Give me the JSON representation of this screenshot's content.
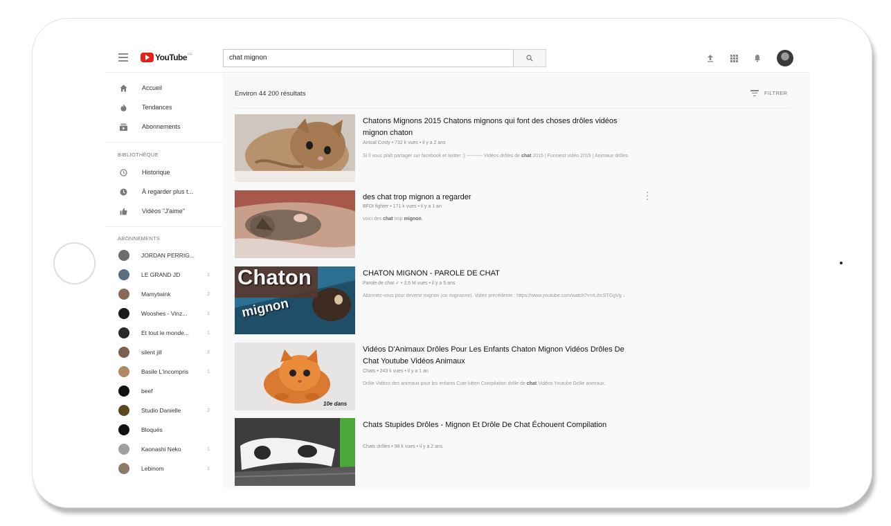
{
  "header": {
    "logo_text": "YouTube",
    "logo_region": "FR",
    "search_value": "chat mignon",
    "icons": [
      "menu-icon",
      "search-icon",
      "upload-icon",
      "apps-icon",
      "bell-icon",
      "avatar"
    ]
  },
  "sidebar": {
    "main_items": [
      {
        "label": "Accueil",
        "icon": "home-icon"
      },
      {
        "label": "Tendances",
        "icon": "flame-icon"
      },
      {
        "label": "Abonnements",
        "icon": "subscriptions-icon"
      }
    ],
    "library_heading": "BIBLIOTHÈQUE",
    "library_items": [
      {
        "label": "Historique",
        "icon": "history-icon"
      },
      {
        "label": "À regarder plus t...",
        "icon": "clock-icon"
      },
      {
        "label": "Vidéos \"J'aime\"",
        "icon": "thumbs-up-icon"
      }
    ],
    "subscriptions_heading": "ABONNEMENTS",
    "subscriptions": [
      {
        "label": "JORDAN PERRIG...",
        "count": "",
        "color": "#6e6e6e"
      },
      {
        "label": "LE GRAND JD",
        "count": "1",
        "color": "#5a6e7e"
      },
      {
        "label": "Mamytwink",
        "count": "2",
        "color": "#8a6a55"
      },
      {
        "label": "Wooshes - Vinz...",
        "count": "1",
        "color": "#1a1a1a"
      },
      {
        "label": "Et tout le monde...",
        "count": "1",
        "color": "#2a2a2a"
      },
      {
        "label": "silent jill",
        "count": "3",
        "color": "#7a6050"
      },
      {
        "label": "Basile L'incompris",
        "count": "1",
        "color": "#b08a60"
      },
      {
        "label": "beef",
        "count": "",
        "color": "#111111"
      },
      {
        "label": "Studio Danielle",
        "count": "2",
        "color": "#5b4a20"
      },
      {
        "label": "Bloqués",
        "count": "",
        "color": "#111111"
      },
      {
        "label": "Kaonashi Neko",
        "count": "1",
        "color": "#a0a0a0"
      },
      {
        "label": "Lebinom",
        "count": "1",
        "color": "#8a7a6a"
      }
    ]
  },
  "main": {
    "result_count": "Environ 44 200 résultats",
    "filter_label": "FILTRER",
    "videos": [
      {
        "title": "Chatons Mignons 2015 Chatons mignons qui font des choses drôles vidéos mignon chaton",
        "meta": "Antoal Costy • 732 k vues • il y a 2 ans",
        "desc_pre": "Si il vous plaît partager sur facebook et twitter :) ---------- Vidéos drôles de ",
        "desc_bold": "chat",
        "desc_post": " 2015 | Funniest vidéo 2015 | Animaux drôles"
      },
      {
        "title": "des chat trop mignon a regarder",
        "meta": "BFDI fighter • 171 k vues • il y a 1 an",
        "desc_pre": "voici des ",
        "desc_bold": "chat",
        "desc_mid": " trop ",
        "desc_bold2": "mignon",
        "desc_post": "."
      },
      {
        "title": "CHATON MIGNON - PAROLE DE CHAT",
        "meta": "Parole de chat ✓ • 3,6 M vues • il y a 5 ans",
        "desc_pre": "Abonnez-vous pour devenir mignon (ou mignonne). Vidéo précédente : https://www.youtube.com/watch?v=rLihcSTGgVg ↓",
        "thumb_text_1": "Chaton",
        "thumb_text_2": "mignon"
      },
      {
        "title": "Vidéos D'Animaux Drôles Pour Les Enfants Chaton Mignon Vidéos Drôles De Chat Youtube Vidéos Animaux",
        "meta": "Chats • 243 k vues • il y a 1 an",
        "desc_pre": "Drôle Vidéos des animaux pour les enfants Cute kitten Compilation drôle de ",
        "desc_bold": "chat",
        "desc_post": " Vidéos Youtube Drôle animaux.",
        "thumb_caption": "10e dans"
      },
      {
        "title": "Chats Stupides Drôles - Mignon Et Drôle De Chat Échouent Compilation",
        "meta": "Chats drôles • 98 k vues • il y a 2 ans"
      }
    ]
  },
  "colors": {
    "brand_red": "#e62117",
    "background": "#f9f9f9"
  }
}
